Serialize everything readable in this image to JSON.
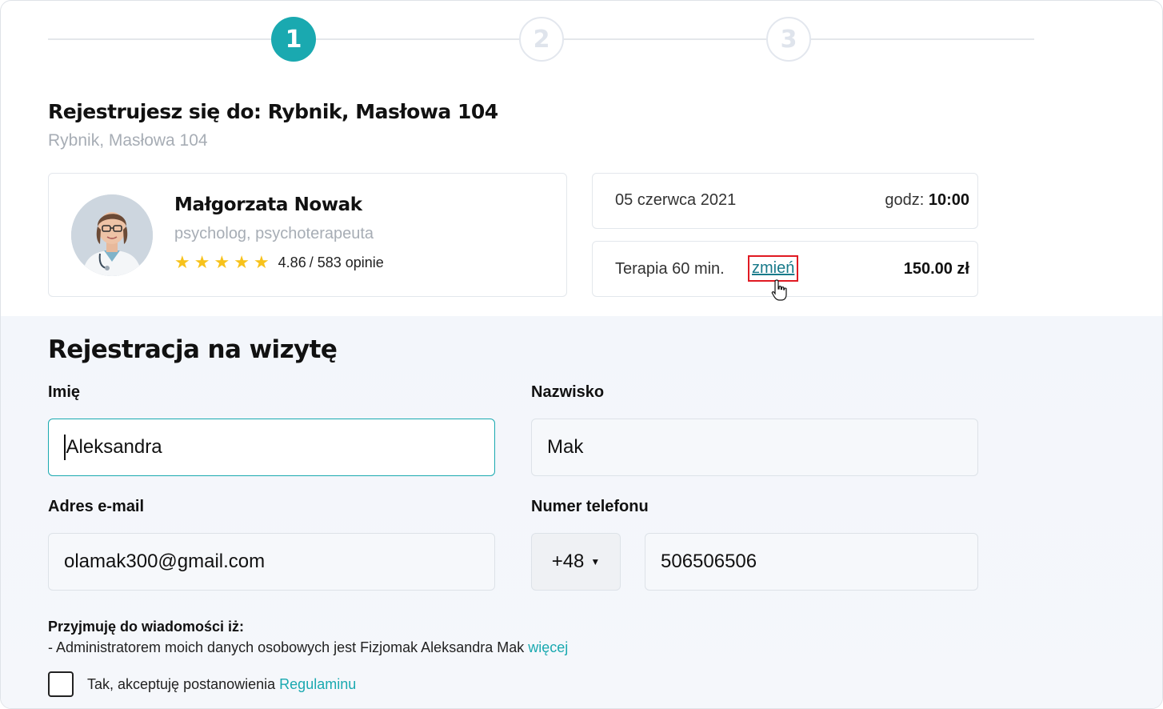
{
  "stepper": {
    "steps": [
      "1",
      "2",
      "3"
    ],
    "active_index": 0
  },
  "header": {
    "title": "Rejestrujesz się do: Rybnik, Masłowa 104",
    "subtitle": "Rybnik, Masłowa 104"
  },
  "doctor": {
    "name": "Małgorzata Nowak",
    "role": "psycholog, psychoterapeuta",
    "stars": 5,
    "rating": "4.86",
    "reviews": "/ 583 opinie"
  },
  "appointment": {
    "date": "05 czerwca 2021",
    "time_label": "godz:",
    "time": "10:00",
    "therapy": "Terapia 60 min.",
    "change_link": "zmień",
    "price": "150.00 zł"
  },
  "form": {
    "title": "Rejestracja na wizytę",
    "first_name_label": "Imię",
    "first_name_value": "Aleksandra",
    "last_name_label": "Nazwisko",
    "last_name_value": "Mak",
    "email_label": "Adres e-mail",
    "email_value": "olamak300@gmail.com",
    "phone_label": "Numer telefonu",
    "phone_prefix": "+48",
    "phone_value": "506506506"
  },
  "consent": {
    "heading": "Przyjmuję do wiadomości iż:",
    "line": "- Administratorem moich danych osobowych jest Fizjomak Aleksandra Mak",
    "more_link": "więcej",
    "terms_text": "Tak, akceptuję postanowienia",
    "terms_link": "Regulaminu"
  },
  "colors": {
    "accent": "#1aa9b0",
    "star": "#f7c21b",
    "highlight": "#e01a22"
  }
}
